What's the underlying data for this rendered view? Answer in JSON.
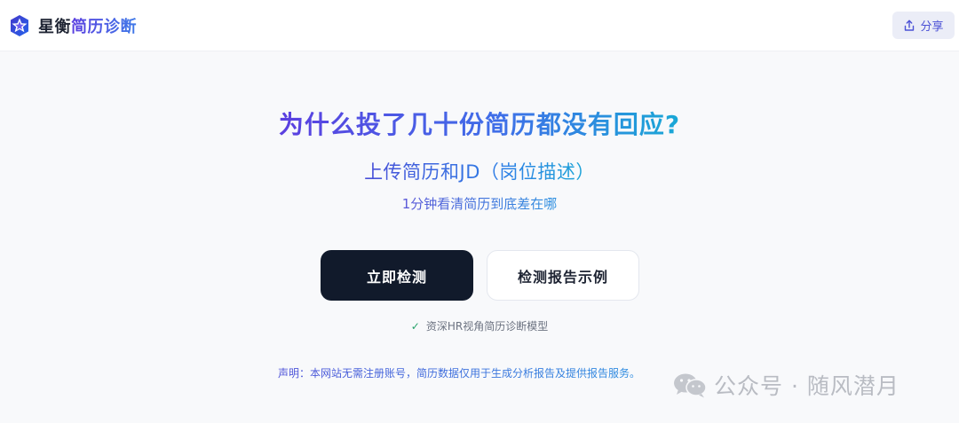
{
  "header": {
    "brand_part1": "星衡",
    "brand_part2": "简历诊断",
    "share_label": "分享"
  },
  "hero": {
    "headline": "为什么投了几十份简历都没有回应?",
    "subhead": "上传简历和JD（岗位描述）",
    "tagline": "1分钟看清简历到底差在哪"
  },
  "actions": {
    "primary_label": "立即检测",
    "secondary_label": "检测报告示例"
  },
  "model_note": "资深HR视角简历诊断模型",
  "disclaimer": "声明：本网站无需注册账号，简历数据仅用于生成分析报告及提供报告服务。",
  "watermark": "公众号 · 随风潜月",
  "icons": {
    "logo": "star-logo-icon",
    "share": "share-icon",
    "check": "check-icon",
    "watermark": "wechat-icon"
  },
  "colors": {
    "accent": "#4b51d6",
    "primary_button": "#111a2b",
    "check": "#27a36b"
  }
}
